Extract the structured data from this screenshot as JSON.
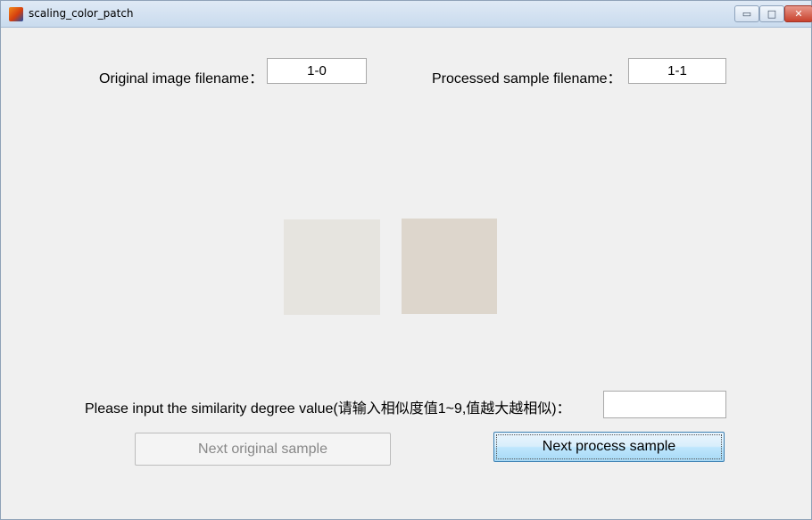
{
  "window": {
    "title": "scaling_color_patch"
  },
  "titlebar_buttons": {
    "minimize": "▭",
    "maximize": "□",
    "close": "✕"
  },
  "form": {
    "original_label": "Original image filename：",
    "original_value": "1-0",
    "processed_label": "Processed sample filename：",
    "processed_value": "1-1",
    "similarity_label": "Please input the similarity degree value(请输入相似度值1~9,值越大越相似)：",
    "similarity_value": ""
  },
  "patches": {
    "original_color": "#e6e4df",
    "processed_color": "#ddd6cc"
  },
  "buttons": {
    "next_original": "Next original sample",
    "next_process": "Next process sample"
  }
}
